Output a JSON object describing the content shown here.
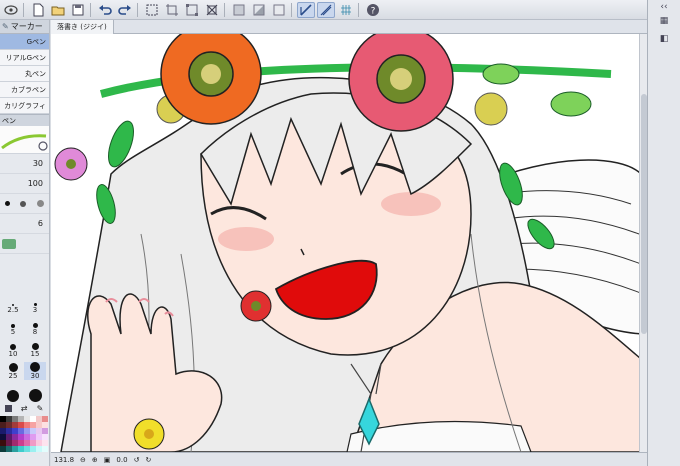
{
  "app": {
    "accent": "#9fb9e2"
  },
  "toolbar": {
    "icons": [
      "new-icon",
      "open-icon",
      "save-icon",
      "undo-icon",
      "redo-icon",
      "transform-icon",
      "crop-icon",
      "free-transform-icon",
      "select-icon",
      "fill-icon",
      "ruler-icon",
      "snap-ruler-icon",
      "snap-grid-icon",
      "snap-icon",
      "help-icon"
    ]
  },
  "left_panel": {
    "subtool_header": "マーカー",
    "subtools": [
      "Gペン",
      "リアルGペン",
      "丸ペン",
      "カブラペン",
      "カリグラフィ"
    ],
    "selected_index": 0,
    "property_label": "ペン",
    "brush_size": "30",
    "opacity": "100",
    "stabilization": "6",
    "brush_sizes": [
      "2.5",
      "3",
      "5",
      "8",
      "10",
      "15",
      "25",
      "30",
      "40",
      "50"
    ],
    "palette_colors": [
      "#000000",
      "#3a3a3a",
      "#7a7a7a",
      "#b5b5b5",
      "#e6e6e6",
      "#ffffff",
      "#f2c9c9",
      "#e88c8c",
      "#4a1d1d",
      "#6b2b2b",
      "#a23b3b",
      "#d94a4a",
      "#f07a7a",
      "#f6a3a3",
      "#f8caca",
      "#fde1e1",
      "#1a1a6b",
      "#2d2da0",
      "#3f3fcc",
      "#6a6ae0",
      "#9b9bf0",
      "#c9c9fa",
      "#e8c9f0",
      "#d29be0",
      "#0d0d3a",
      "#5a1a6b",
      "#8a2ba0",
      "#b23fcc",
      "#ca6ae0",
      "#df9bf0",
      "#efc9fa",
      "#f7e3fd",
      "#3a0d0d",
      "#6b1a4a",
      "#a02b6e",
      "#cc3f8f",
      "#e06aab",
      "#f09bc6",
      "#facade",
      "#fde3ee",
      "#0d3a3a",
      "#1a6b6b",
      "#2ba0a0",
      "#3fcccc",
      "#6ae0e0",
      "#9bf0f0",
      "#c9fafa",
      "#e3fdfd"
    ]
  },
  "canvas": {
    "tab_label": "落書き (ジジイ)",
    "zoom": "131.8",
    "rotation": "0.0"
  },
  "colors": {
    "flower_orange": "#ef6a22",
    "flower_pink": "#e75a73",
    "flower_center": "#6f8a2a",
    "leaf": "#2fb84a",
    "mouth": "#e00b0b",
    "gem": "#36d6dc",
    "yellow_flower": "#f1de2a",
    "skin": "#fde7de",
    "blush": "#f5b9b2"
  }
}
